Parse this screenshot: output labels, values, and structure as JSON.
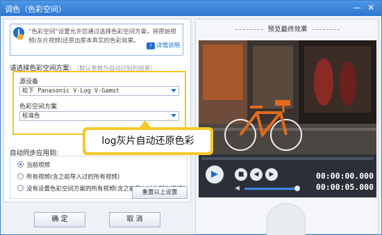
{
  "window": {
    "title": "调色（色彩空间）",
    "minimize_glyph": "—",
    "close_glyph": "✕"
  },
  "info": {
    "icon": "info-icon",
    "text": "“色彩空间”设置允许您通过选择色彩空间方案，将原始视频(灰片视频)还原出原本真实的色彩效果。",
    "details_link": "详情说明"
  },
  "colorspace": {
    "section_label": "请选择色彩空间方案:",
    "section_hint": "（默认参数为自动识别的结果）",
    "source_device_label": "源设备",
    "source_device_value": "松下 Panasonic V-Log V-Gamut",
    "scheme_label": "色彩空间方案",
    "scheme_value": "标准色"
  },
  "sync": {
    "label": "自动同步应用到:",
    "options": [
      {
        "label": "当前视频",
        "selected": true
      },
      {
        "label": "所有视频(含之前导入过的所有视频)",
        "selected": false
      },
      {
        "label": "没有设置色彩空间方案的所有视频(含之前导入过的所有视频)",
        "selected": false
      }
    ],
    "reset_button": "重置以上设置"
  },
  "buttons": {
    "ok": "确 定",
    "cancel": "取 消"
  },
  "preview": {
    "title": "预览最终效果",
    "current_time": "00:00:00.000",
    "total_time": "00:00:05.000",
    "volume_level": 1.0,
    "progress": 0.0
  },
  "callout": {
    "text": "log灰片自动还原色彩"
  }
}
